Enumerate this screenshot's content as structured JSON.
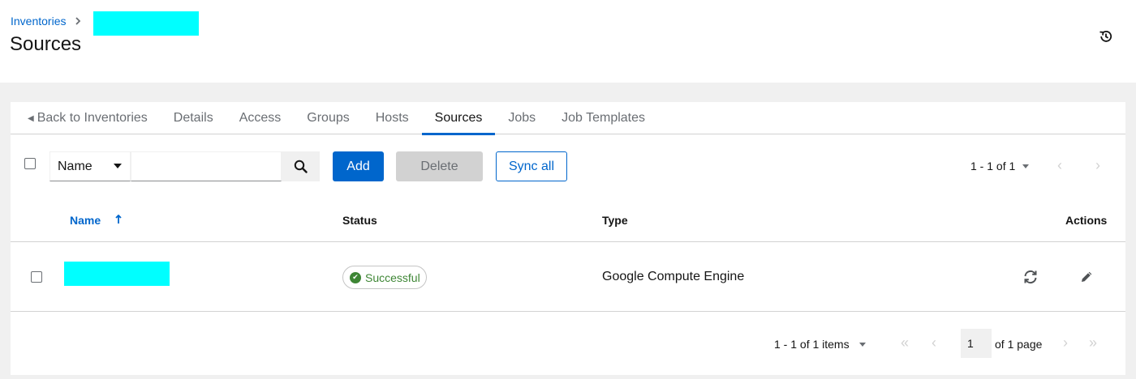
{
  "header": {
    "breadcrumb_root": "Inventories",
    "title": "Sources",
    "redaction_color": "#00ffff"
  },
  "tabs": [
    {
      "label": "Back to Inventories",
      "active": false
    },
    {
      "label": "Details",
      "active": false
    },
    {
      "label": "Access",
      "active": false
    },
    {
      "label": "Groups",
      "active": false
    },
    {
      "label": "Hosts",
      "active": false
    },
    {
      "label": "Sources",
      "active": true
    },
    {
      "label": "Jobs",
      "active": false
    },
    {
      "label": "Job Templates",
      "active": false
    }
  ],
  "toolbar": {
    "filter_select": "Name",
    "search_value": "",
    "search_placeholder": "",
    "add_label": "Add",
    "delete_label": "Delete",
    "sync_all_label": "Sync all",
    "range_label": "1 - 1 of 1"
  },
  "table": {
    "columns": [
      "Name",
      "Status",
      "Type",
      "Actions"
    ],
    "sort": "ascending",
    "rows": [
      {
        "name": "",
        "status": "Successful",
        "type": "Google Compute Engine"
      }
    ]
  },
  "pagination": {
    "range_label": "1 - 1 of 1 items",
    "current_page": "1",
    "page_of_label": "of 1 page"
  },
  "colors": {
    "accent": "#0066cc",
    "success": "#3e8635",
    "background": "#f0f0f0"
  }
}
